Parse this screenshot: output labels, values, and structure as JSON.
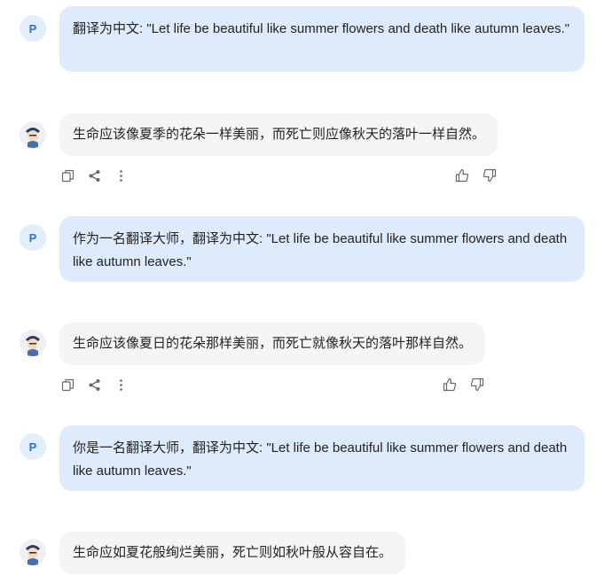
{
  "messages": [
    {
      "role": "user",
      "avatar": "P",
      "text": "翻译为中文: \"Let life be beautiful like summer flowers and death like autumn leaves.\""
    },
    {
      "role": "assistant",
      "avatar_icon": "bot-avatar",
      "text": "生命应该像夏季的花朵一样美丽，而死亡则应像秋天的落叶一样自然。"
    },
    {
      "role": "user",
      "avatar": "P",
      "text": "作为一名翻译大师，翻译为中文: \"Let life be beautiful like summer flowers and death like autumn leaves.\""
    },
    {
      "role": "assistant",
      "avatar_icon": "bot-avatar",
      "text": "生命应该像夏日的花朵那样美丽，而死亡就像秋天的落叶那样自然。"
    },
    {
      "role": "user",
      "avatar": "P",
      "text": "你是一名翻译大师，翻译为中文: \"Let life be beautiful like summer flowers and death like autumn leaves.\""
    },
    {
      "role": "assistant",
      "avatar_icon": "bot-avatar",
      "text": "生命应如夏花般绚烂美丽，死亡则如秋叶般从容自在。"
    }
  ],
  "actions": {
    "left": [
      "copy-icon",
      "share-icon",
      "more-icon"
    ],
    "right": [
      "thumbs-up-icon",
      "thumbs-down-icon"
    ]
  },
  "colors": {
    "user_bubble": "#ddebfd",
    "bot_bubble": "#f4f5f7",
    "user_avatar_bg": "#e3eefc",
    "user_avatar_text": "#2f6fd6",
    "icon": "#666666"
  }
}
